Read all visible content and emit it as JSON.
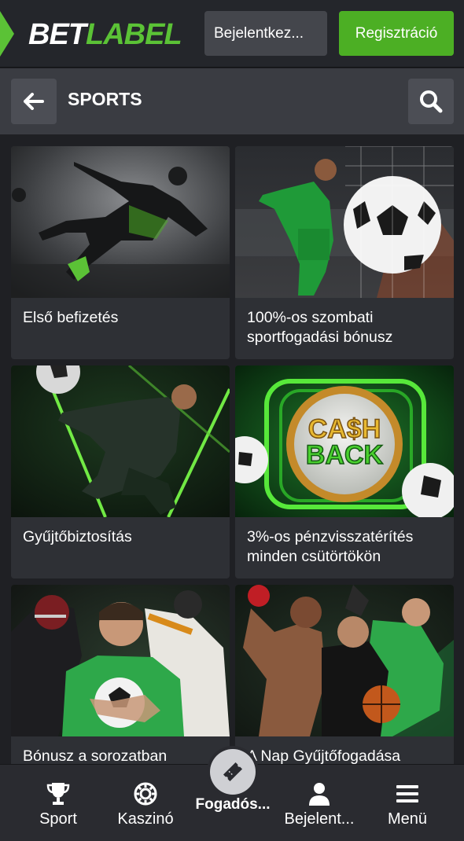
{
  "header": {
    "logo_part1": "BET",
    "logo_part2": "LABEL",
    "login_label": "Bejelentkez...",
    "register_label": "Regisztráció"
  },
  "subheader": {
    "title": "SPORTS"
  },
  "promos": [
    {
      "title": "Első befizetés",
      "image": "soccer-player-kick"
    },
    {
      "title": "100%-os szombati sportfogadási bónusz",
      "image": "soccer-goal-celebration"
    },
    {
      "title": "Gyűjtőbiztosítás",
      "image": "soccer-player-green-lights"
    },
    {
      "title": "3%-os pénzvisszatérítés minden csütörtökön",
      "image": "cashback-badge"
    },
    {
      "title": "Bónusz a sorozatban",
      "image": "multi-sport-athletes"
    },
    {
      "title": "A Nap Gyűjtőfogadása",
      "image": "athletes-group"
    }
  ],
  "bottom_nav": {
    "sport": "Sport",
    "casino": "Kaszinó",
    "betslip": "Fogadós...",
    "login": "Bejelent...",
    "menu": "Menü"
  },
  "colors": {
    "brand_green": "#5bc236",
    "register_green": "#4caf24",
    "background": "#1f2024",
    "card": "#2e3035"
  }
}
